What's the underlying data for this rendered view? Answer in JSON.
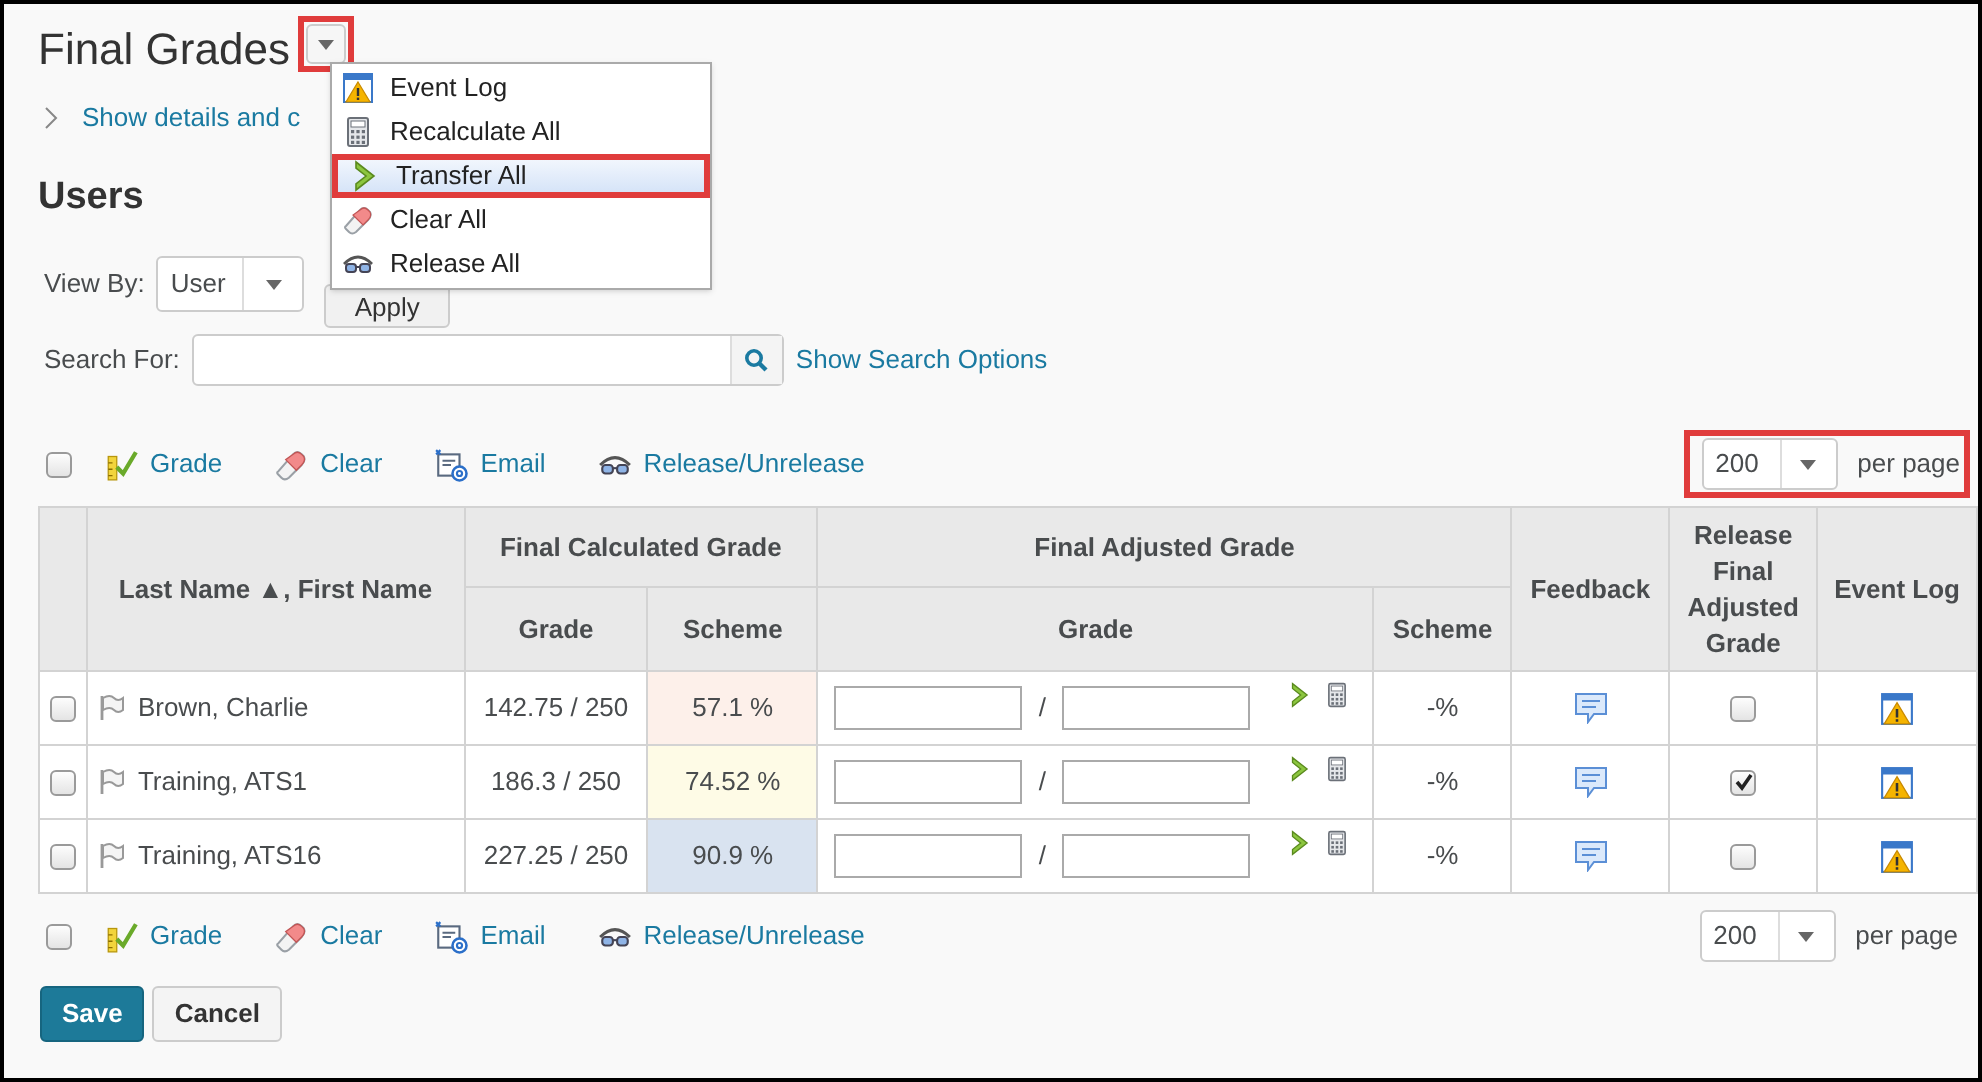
{
  "title": "Final Grades",
  "title_menu": {
    "highlighted": true,
    "items": [
      {
        "kind": "event-log",
        "label": "Event Log",
        "selected": false,
        "highlighted": false
      },
      {
        "kind": "calculator",
        "label": "Recalculate All",
        "selected": false,
        "highlighted": false
      },
      {
        "kind": "transfer",
        "label": "Transfer All",
        "selected": true,
        "highlighted": true
      },
      {
        "kind": "eraser",
        "label": "Clear All",
        "selected": false,
        "highlighted": false
      },
      {
        "kind": "release",
        "label": "Release All",
        "selected": false,
        "highlighted": false
      }
    ]
  },
  "details_link": "Show details and c",
  "section_title": "Users",
  "view_by": {
    "label": "View By:",
    "value": "User",
    "button": "Apply"
  },
  "search": {
    "label": "Search For:",
    "link": "Show Search Options"
  },
  "toolbar_top": {
    "select_all": {
      "checked": false
    },
    "actions": [
      {
        "kind": "grade",
        "label": "Grade"
      },
      {
        "kind": "eraser",
        "label": "Clear"
      },
      {
        "kind": "email",
        "label": "Email"
      },
      {
        "kind": "release",
        "label": "Release/Unrelease"
      }
    ],
    "per_page": {
      "value": "200",
      "label": "per page",
      "highlighted": true
    }
  },
  "table": {
    "headers": {
      "name": "Last Name ▲, First Name",
      "calculated": "Final Calculated Grade",
      "calc_grade": "Grade",
      "calc_scheme": "Scheme",
      "adjusted": "Final Adjusted Grade",
      "adj_grade": "Grade",
      "adj_scheme": "Scheme",
      "feedback": "Feedback",
      "release": "Release Final Adjusted Grade",
      "event_log": "Event Log"
    },
    "rows": [
      {
        "selected": false,
        "name": "Brown, Charlie",
        "grade": "142.75 / 250",
        "scheme": "57.1 %",
        "color": "#fdf0ea",
        "separator": "/",
        "adjusted_scheme": "-%",
        "released": false
      },
      {
        "selected": false,
        "name": "Training, ATS1",
        "grade": "186.3 / 250",
        "scheme": "74.52 %",
        "color": "#fefbe6",
        "separator": "/",
        "adjusted_scheme": "-%",
        "released": true
      },
      {
        "selected": false,
        "name": "Training, ATS16",
        "grade": "227.25 / 250",
        "scheme": "90.9 %",
        "color": "#d9e3f0",
        "separator": "/",
        "adjusted_scheme": "-%",
        "released": false
      }
    ]
  },
  "toolbar_bottom": {
    "select_all": {
      "checked": false
    },
    "actions": [
      {
        "kind": "grade",
        "label": "Grade"
      },
      {
        "kind": "eraser",
        "label": "Clear"
      },
      {
        "kind": "email",
        "label": "Email"
      },
      {
        "kind": "release",
        "label": "Release/Unrelease"
      }
    ],
    "per_page": {
      "value": "200",
      "label": "per page"
    }
  },
  "buttons": [
    {
      "kind": "primary",
      "label": "Save"
    },
    {
      "kind": "secondary",
      "label": "Cancel"
    }
  ]
}
